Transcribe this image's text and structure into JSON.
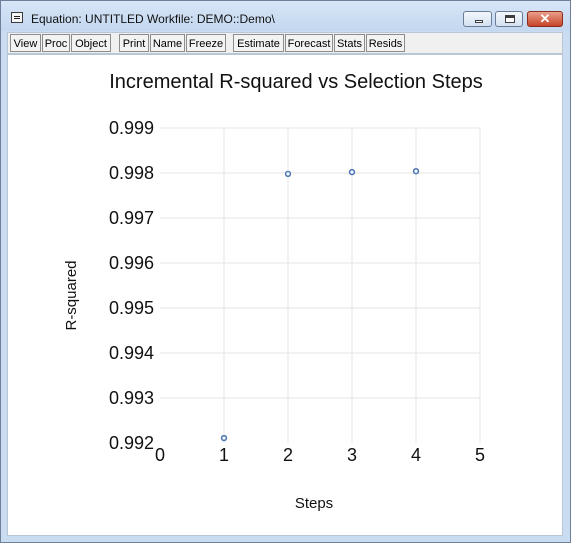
{
  "window": {
    "title": "Equation: UNTITLED   Workfile: DEMO::Demo\\",
    "controls": {
      "close": "✕"
    }
  },
  "toolbar": {
    "buttons": [
      "View",
      "Proc",
      "Object",
      "Print",
      "Name",
      "Freeze",
      "Estimate",
      "Forecast",
      "Stats",
      "Resids"
    ]
  },
  "chart_data": {
    "type": "scatter",
    "title": "Incremental R-squared vs Selection Steps",
    "xlabel": "Steps",
    "ylabel": "R-squared",
    "x": [
      1,
      2,
      3,
      4
    ],
    "y": [
      0.99211,
      0.99798,
      0.99802,
      0.99804
    ],
    "xlim": [
      0,
      5
    ],
    "ylim": [
      0.992,
      0.999
    ],
    "xticks": [
      "0",
      "1",
      "2",
      "3",
      "4",
      "5"
    ],
    "yticks": [
      "0.999",
      "0.998",
      "0.997",
      "0.996",
      "0.995",
      "0.994",
      "0.993",
      "0.992"
    ],
    "grid": true,
    "marker_color": "#4f79b6"
  }
}
